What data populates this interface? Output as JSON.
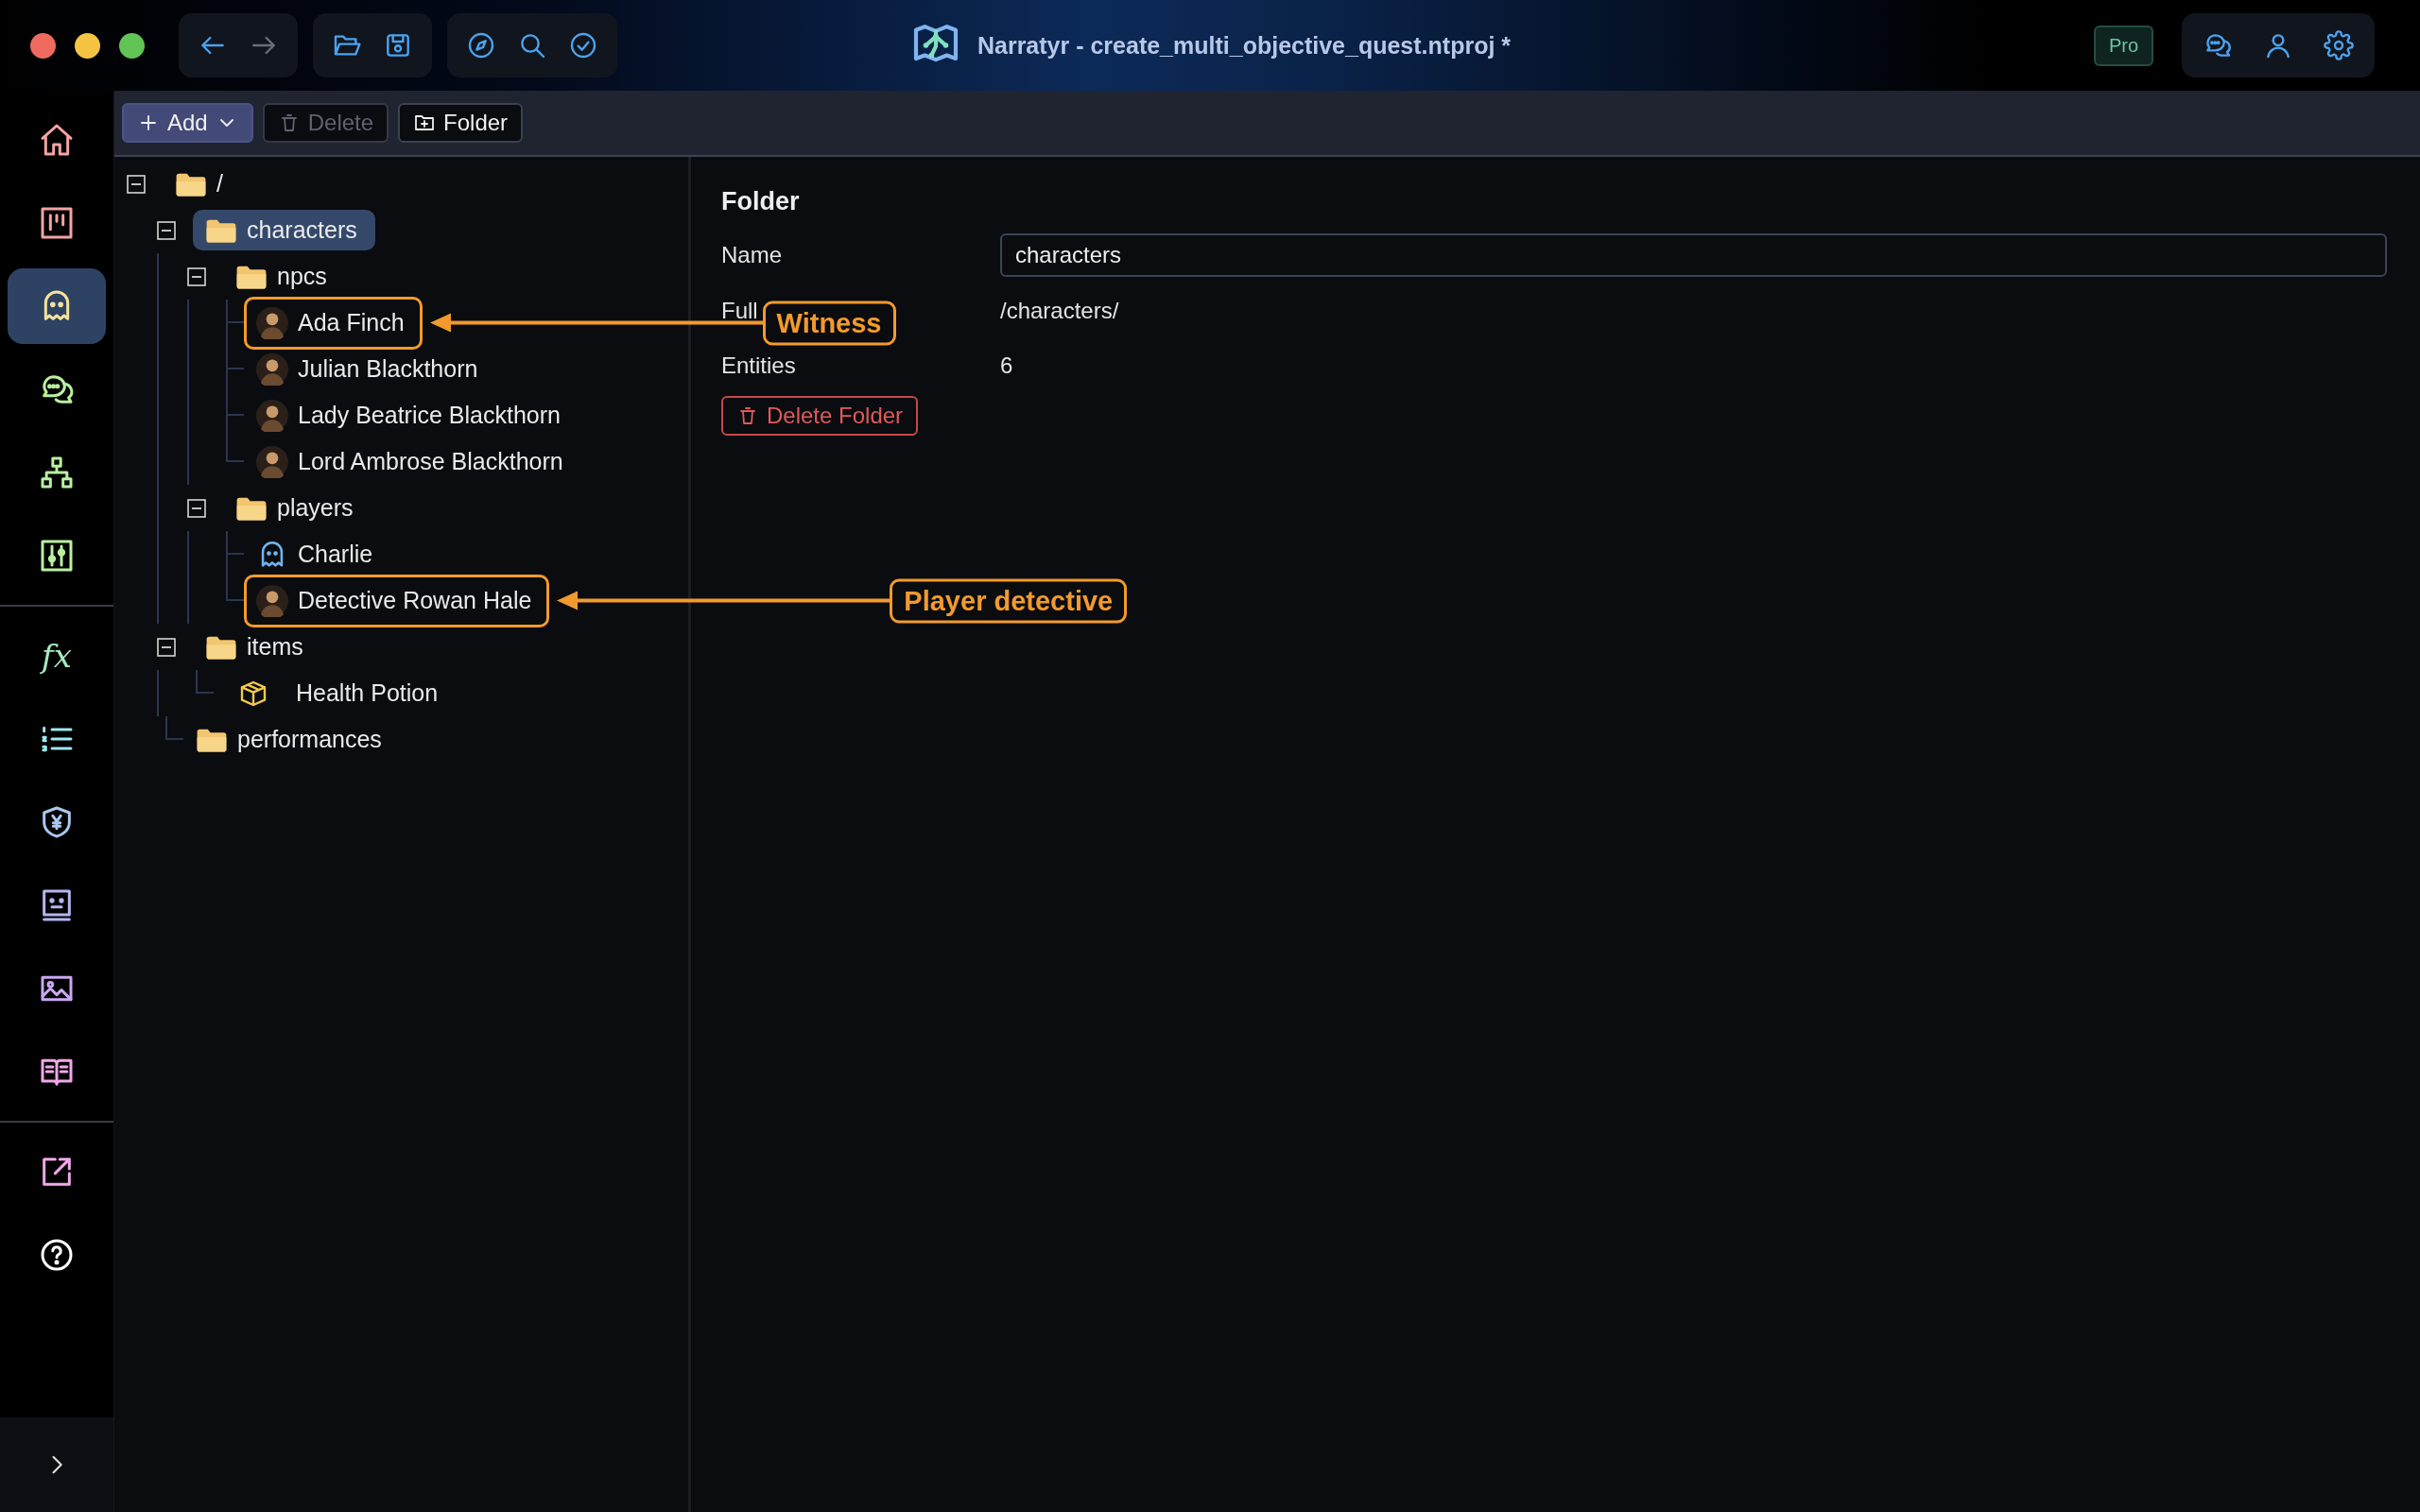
{
  "window": {
    "title": "Narratyr - create_multi_objective_quest.ntproj *",
    "badge": "Pro"
  },
  "nav_groups": [
    [
      {
        "disabled": false
      },
      {
        "disabled": true
      }
    ],
    [
      {
        "disabled": false
      },
      {
        "disabled": false
      }
    ],
    [
      {
        "disabled": false
      },
      {
        "disabled": false
      },
      {
        "disabled": false
      }
    ]
  ],
  "sidebar": {
    "items": [
      {
        "kind": "icon",
        "selected": false
      },
      {
        "kind": "icon",
        "selected": false
      },
      {
        "kind": "icon",
        "selected": true
      },
      {
        "kind": "icon",
        "selected": false
      },
      {
        "kind": "icon",
        "selected": false
      },
      {
        "kind": "icon",
        "selected": false
      },
      {
        "kind": "divider"
      },
      {
        "kind": "text",
        "label": "fx",
        "selected": false
      },
      {
        "kind": "icon",
        "selected": false
      },
      {
        "kind": "icon",
        "selected": false
      },
      {
        "kind": "icon",
        "selected": false
      },
      {
        "kind": "icon",
        "selected": false
      },
      {
        "kind": "icon",
        "selected": false
      },
      {
        "kind": "divider"
      },
      {
        "kind": "icon",
        "selected": false
      },
      {
        "kind": "icon",
        "selected": false
      }
    ]
  },
  "toolbar": {
    "buttons": [
      {
        "kind": "add",
        "label": "Add",
        "disabled": false
      },
      {
        "kind": "delete",
        "label": "Delete",
        "disabled": true
      },
      {
        "kind": "folder",
        "label": "Folder",
        "disabled": false
      }
    ]
  },
  "tree": {
    "root": {
      "kind": "folder",
      "label": "/",
      "expanded": true,
      "selected": false,
      "children": [
        {
          "kind": "folder",
          "label": "characters",
          "expanded": true,
          "selected": true,
          "children": [
            {
              "kind": "folder",
              "label": "npcs",
              "expanded": true,
              "selected": false,
              "children": [
                {
                  "kind": "character",
                  "label": "Ada Finch",
                  "selected": false,
                  "callout": "Witness"
                },
                {
                  "kind": "character",
                  "label": "Julian Blackthorn",
                  "selected": false
                },
                {
                  "kind": "character",
                  "label": "Lady Beatrice Blackthorn",
                  "selected": false
                },
                {
                  "kind": "character",
                  "label": "Lord Ambrose Blackthorn",
                  "selected": false
                }
              ]
            },
            {
              "kind": "folder",
              "label": "players",
              "expanded": true,
              "selected": false,
              "children": [
                {
                  "kind": "player",
                  "label": "Charlie",
                  "selected": false
                },
                {
                  "kind": "character",
                  "label": "Detective Rowan Hale",
                  "selected": false,
                  "callout": "Player detective"
                }
              ]
            }
          ]
        },
        {
          "kind": "folder",
          "label": "items",
          "expanded": true,
          "selected": false,
          "children": [
            {
              "kind": "item",
              "label": "Health Potion",
              "selected": false
            }
          ]
        },
        {
          "kind": "folder",
          "label": "performances",
          "selected": false
        }
      ]
    }
  },
  "details": {
    "title": "Folder",
    "fields": [
      {
        "kind": "input",
        "label": "Name",
        "value": "characters"
      },
      {
        "kind": "text",
        "label": "Full",
        "value": "/characters/"
      },
      {
        "kind": "text",
        "label": "Entities",
        "value": "6"
      }
    ],
    "delete_button": "Delete Folder"
  }
}
